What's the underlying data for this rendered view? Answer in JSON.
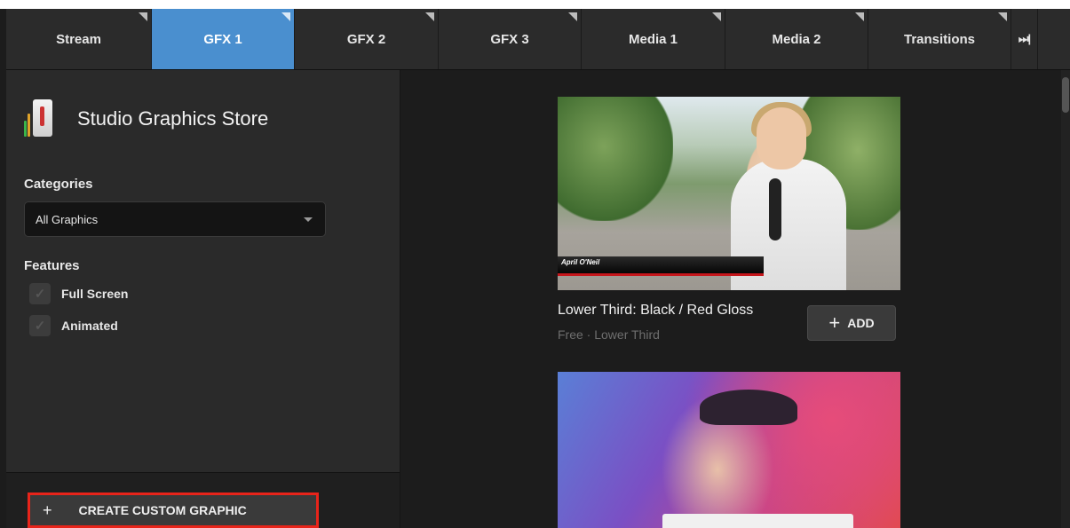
{
  "tabs": [
    {
      "label": "Stream",
      "active": false
    },
    {
      "label": "GFX 1",
      "active": true
    },
    {
      "label": "GFX 2",
      "active": false
    },
    {
      "label": "GFX 3",
      "active": false
    },
    {
      "label": "Media 1",
      "active": false
    },
    {
      "label": "Media 2",
      "active": false
    },
    {
      "label": "Transitions",
      "active": false
    }
  ],
  "tab_more_icon": "⏭|",
  "store": {
    "title": "Studio Graphics Store",
    "icon": "graphics-store-icon"
  },
  "filters": {
    "categories_label": "Categories",
    "category_selected": "All Graphics",
    "features_label": "Features",
    "features": [
      {
        "label": "Full Screen",
        "checked": false
      },
      {
        "label": "Animated",
        "checked": false
      }
    ]
  },
  "footer": {
    "create_label": "CREATE CUSTOM GRAPHIC",
    "create_icon": "+"
  },
  "items": [
    {
      "title": "Lower Third: Black / Red Gloss",
      "meta": "Free · Lower Third",
      "add_label": "ADD",
      "add_icon": "+",
      "overlay_text": "April O'Neil"
    }
  ],
  "colors": {
    "accent_tab": "#4a8fcf",
    "highlight_border": "#e8241a"
  }
}
